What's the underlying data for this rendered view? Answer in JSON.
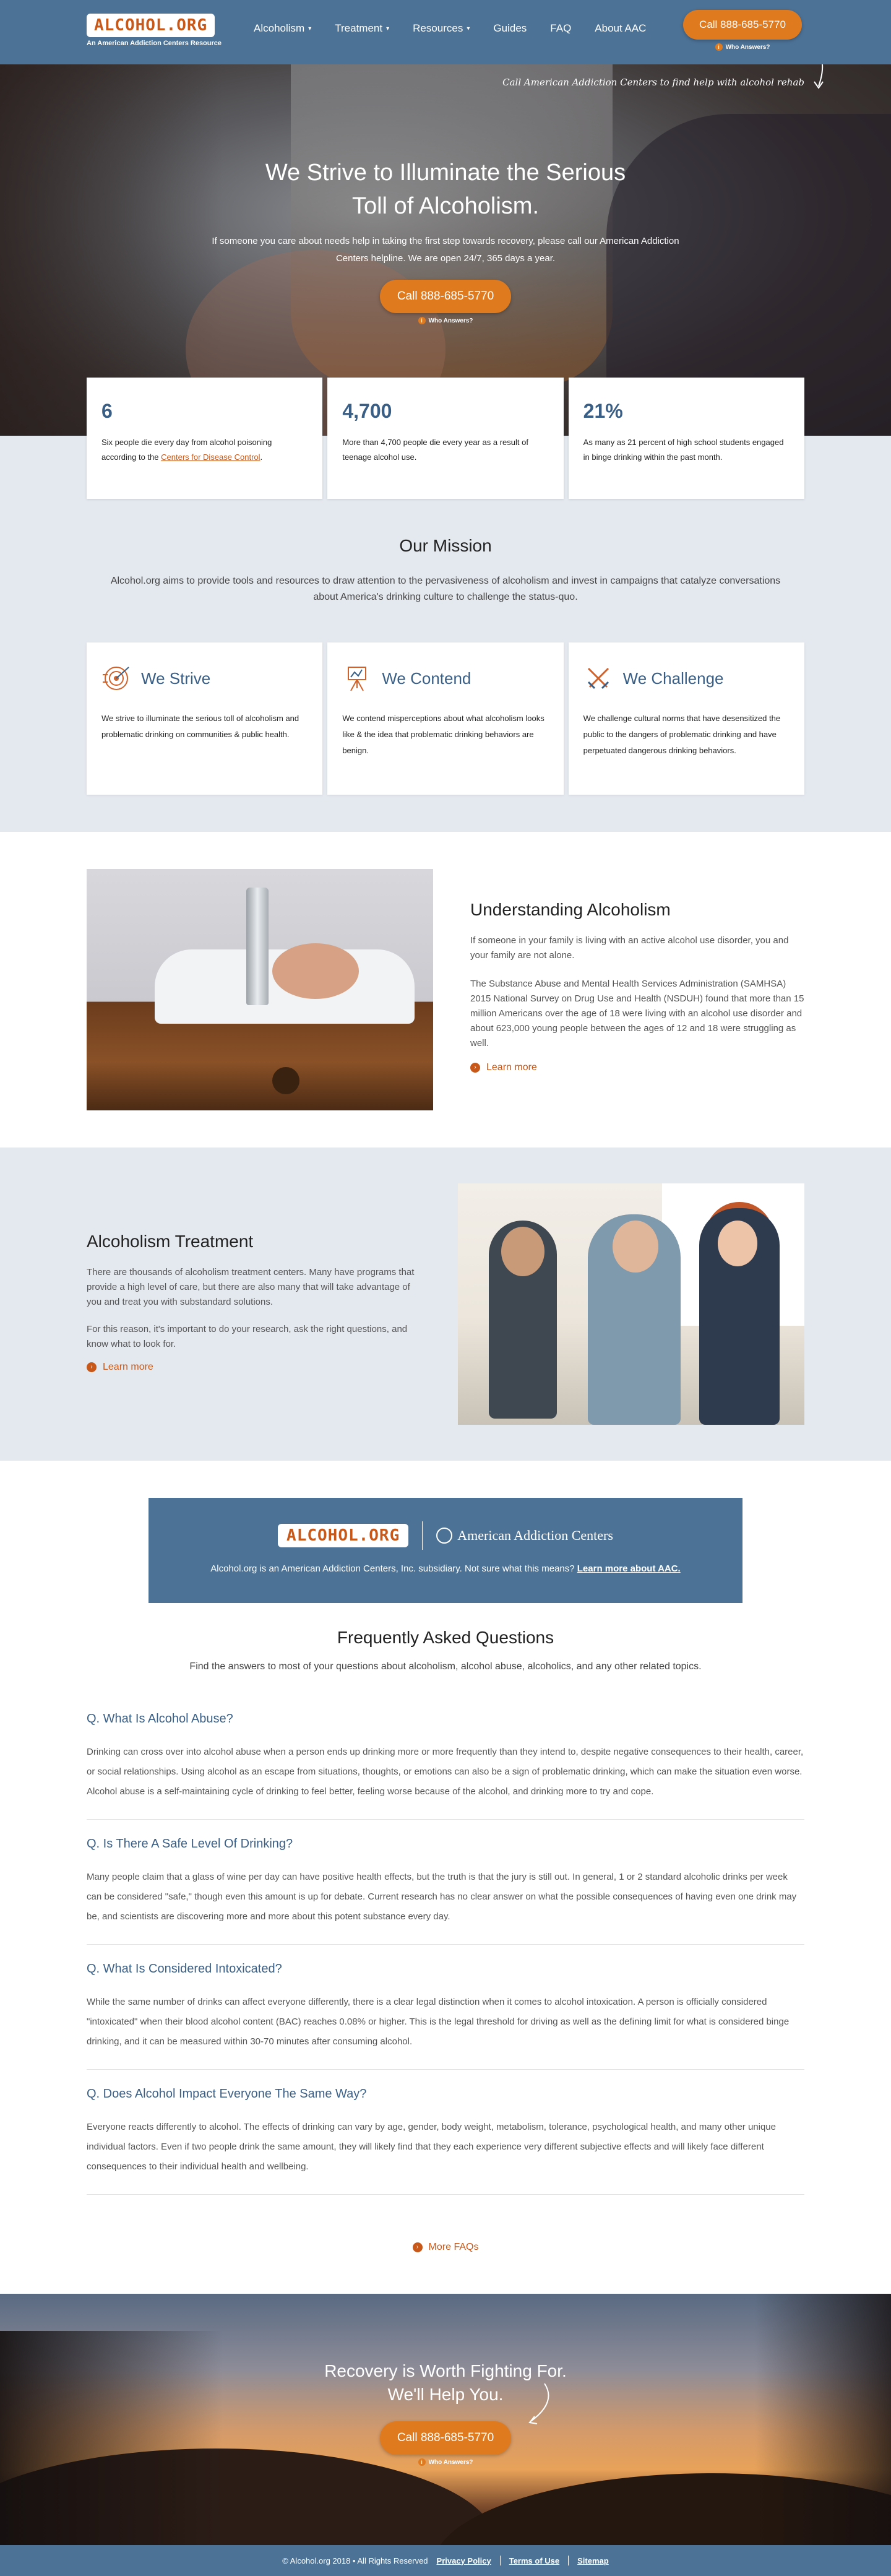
{
  "header": {
    "logo_text": "ALCOHOL.ORG",
    "logo_sub": "An American Addiction Centers Resource",
    "nav": [
      {
        "label": "Alcoholism",
        "has_caret": true
      },
      {
        "label": "Treatment",
        "has_caret": true
      },
      {
        "label": "Resources",
        "has_caret": true
      },
      {
        "label": "Guides",
        "has_caret": false
      },
      {
        "label": "FAQ",
        "has_caret": false
      },
      {
        "label": "About AAC",
        "has_caret": false
      }
    ],
    "call_label": "Call 888-685-5770",
    "who_answers": "Who Answers?"
  },
  "hero": {
    "tagline": "Call American Addiction Centers to find help with alcohol rehab",
    "title_line1": "We Strive to Illuminate the Serious",
    "title_line2": "Toll of Alcoholism.",
    "text": "If someone you care about needs help in taking the first step towards recovery, please call our American Addiction Centers helpline. We are open 24/7, 365 days a year.",
    "call_label": "Call 888-685-5770",
    "who_answers": "Who Answers?"
  },
  "stats": [
    {
      "number": "6",
      "text": "Six people die every day from alcohol poisoning according to the ",
      "link": "Centers for Disease Control",
      "after": "."
    },
    {
      "number": "4,700",
      "text": "More than 4,700 people die every year as a result of teenage alcohol use.",
      "link": "",
      "after": ""
    },
    {
      "number": "21%",
      "text": "As many as 21 percent of high school students engaged in binge drinking within the past month.",
      "link": "",
      "after": ""
    }
  ],
  "mission": {
    "title": "Our Mission",
    "text": "Alcohol.org aims to provide tools and resources to draw attention to the pervasiveness of alcoholism and invest in campaigns that catalyze conversations about America's drinking culture to challenge the status-quo.",
    "cards": [
      {
        "title": "We Strive",
        "icon": "target-icon",
        "text": "We strive to illuminate the serious toll of alcoholism and problematic drinking on communities & public health."
      },
      {
        "title": "We Contend",
        "icon": "easel-icon",
        "text": "We contend misperceptions about what alcoholism looks like & the idea that problematic drinking behaviors are benign."
      },
      {
        "title": "We Challenge",
        "icon": "crossed-swords-icon",
        "text": "We challenge cultural norms that have desensitized the public to the dangers of problematic drinking and have perpetuated dangerous drinking behaviors."
      }
    ]
  },
  "understanding": {
    "title": "Understanding Alcoholism",
    "p1": "If someone in your family is living with an active alcohol use disorder, you and your family are not alone.",
    "p2": "The Substance Abuse and Mental Health Services Administration (SAMHSA) 2015 National Survey on Drug Use and Health (NSDUH) found that more than 15 million Americans over the age of 18 were living with an alcohol use disorder and about 623,000 young people between the ages of 12 and 18 were struggling as well.",
    "learn_more": "Learn more"
  },
  "treatment": {
    "title": "Alcoholism Treatment",
    "p1": "There are thousands of alcoholism treatment centers. Many have programs that provide a high level of care, but there are also many that will take advantage of you and treat you with substandard solutions.",
    "p2": "For this reason, it's important to do your research, ask the right questions, and know what to look for.",
    "learn_more": "Learn more"
  },
  "aac_banner": {
    "logo_text": "ALCOHOL.ORG",
    "aac_name": "American Addiction Centers",
    "text": "Alcohol.org is an American Addiction Centers, Inc. subsidiary. Not sure what this means? ",
    "link": "Learn more about AAC."
  },
  "faq": {
    "title": "Frequently Asked Questions",
    "intro": "Find the answers to most of your questions about alcoholism, alcohol abuse, alcoholics, and any other related topics.",
    "items": [
      {
        "q": "Q. What Is Alcohol Abuse?",
        "a": "Drinking can cross over into alcohol abuse when a person ends up drinking more or more frequently than they intend to, despite negative consequences to their health, career, or social relationships. Using alcohol as an escape from situations, thoughts, or emotions can also be a sign of problematic drinking, which can make the situation even worse. Alcohol abuse is a self-maintaining cycle of drinking to feel better, feeling worse because of the alcohol, and drinking more to try and cope."
      },
      {
        "q": "Q. Is There A Safe Level Of Drinking?",
        "a": "Many people claim that a glass of wine per day can have positive health effects, but the truth is that the jury is still out. In general, 1 or 2 standard alcoholic drinks per week can be considered \"safe,\" though even this amount is up for debate. Current research has no clear answer on what the possible consequences of having even one drink may be, and scientists are discovering more and more about this potent substance every day."
      },
      {
        "q": "Q. What Is Considered Intoxicated?",
        "a": "While the same number of drinks can affect everyone differently, there is a clear legal distinction when it comes to alcohol intoxication. A person is officially considered \"intoxicated\" when their blood alcohol content (BAC) reaches 0.08% or higher. This is the legal threshold for driving as well as the defining limit for what is considered binge drinking, and it can be measured within 30-70 minutes after consuming alcohol."
      },
      {
        "q": "Q. Does Alcohol Impact Everyone The Same Way?",
        "a": "Everyone reacts differently to alcohol. The effects of drinking can vary by age, gender, body weight, metabolism, tolerance, psychological health, and many other unique individual factors. Even if two people drink the same amount, they will likely find that they each experience very different subjective effects and will likely face different consequences to their individual health and wellbeing."
      }
    ],
    "more_label": "More FAQs"
  },
  "footer_cta": {
    "line1": "Recovery is Worth Fighting For.",
    "line2": "We'll Help You.",
    "call_label": "Call 888-685-5770",
    "who_answers": "Who Answers?"
  },
  "bottom": {
    "copyright": "© Alcohol.org 2018 • All Rights Reserved",
    "privacy": "Privacy Policy",
    "terms": "Terms of Use",
    "sitemap": "Sitemap"
  },
  "colors": {
    "brand_blue": "#4c7296",
    "accent_orange": "#e07a1f",
    "heading_blue": "#3a5f86",
    "section_gray": "#e4e9ef"
  }
}
